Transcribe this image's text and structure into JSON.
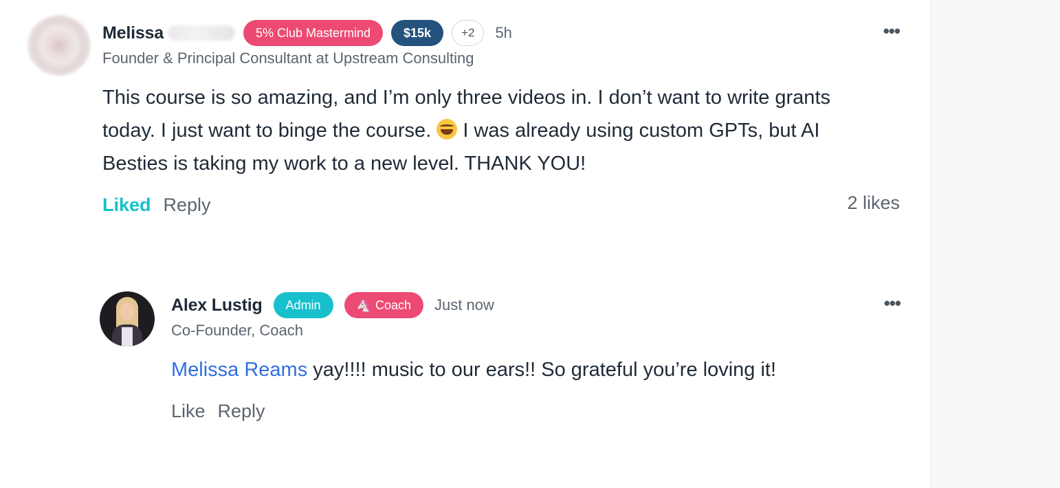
{
  "comment": {
    "author": "Melissa",
    "badges": [
      "5% Club Mastermind",
      "$15k",
      "+2"
    ],
    "time": "5h",
    "subtitle": "Founder & Principal Consultant at Upstream Consulting",
    "text_part1": "This course is so amazing, and I’m only three videos in. I don’t want to write grants today. I just want to binge the course. ",
    "emoji": "rolling-on-the-floor-laughing",
    "text_part2": " I was already using custom GPTs, but AI Besties is taking my work to a new level. THANK YOU!",
    "actions": {
      "liked": "Liked",
      "reply": "Reply"
    },
    "likes": "2 likes"
  },
  "reply": {
    "author": "Alex Lustig",
    "badges": [
      "Admin",
      "🦄 Coach"
    ],
    "time": "Just now",
    "subtitle": "Co-Founder, Coach",
    "mention": "Melissa Reams",
    "text": " yay!!!! music to our ears!! So grateful you’re loving it!",
    "actions": {
      "like": "Like",
      "reply": "Reply"
    }
  },
  "colors": {
    "accent_teal": "#17c0cc",
    "badge_pink": "#ed4a73",
    "badge_navy": "#24527d",
    "mention_blue": "#2f6fe0"
  }
}
